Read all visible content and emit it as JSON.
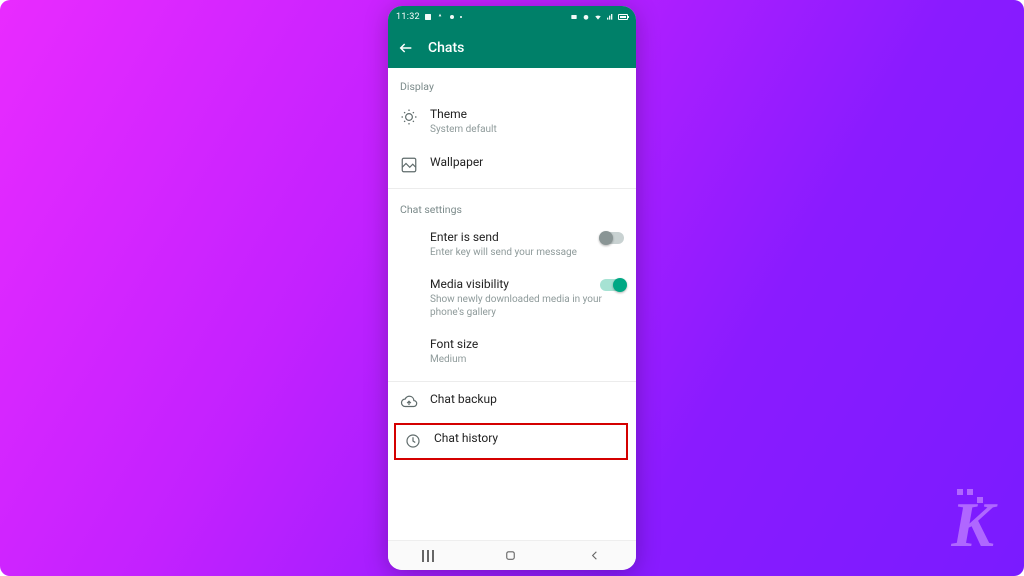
{
  "statusbar": {
    "time": "11:32"
  },
  "appbar": {
    "title": "Chats"
  },
  "section_display": {
    "header": "Display",
    "theme": {
      "title": "Theme",
      "sub": "System default"
    },
    "wallpaper": {
      "title": "Wallpaper"
    }
  },
  "section_chat": {
    "header": "Chat settings",
    "enter_is_send": {
      "title": "Enter is send",
      "sub": "Enter key will send your message",
      "on": false
    },
    "media_visibility": {
      "title": "Media visibility",
      "sub": "Show newly downloaded media in your phone's gallery",
      "on": true
    },
    "font_size": {
      "title": "Font size",
      "sub": "Medium"
    }
  },
  "chat_backup": {
    "title": "Chat backup"
  },
  "chat_history": {
    "title": "Chat history"
  }
}
